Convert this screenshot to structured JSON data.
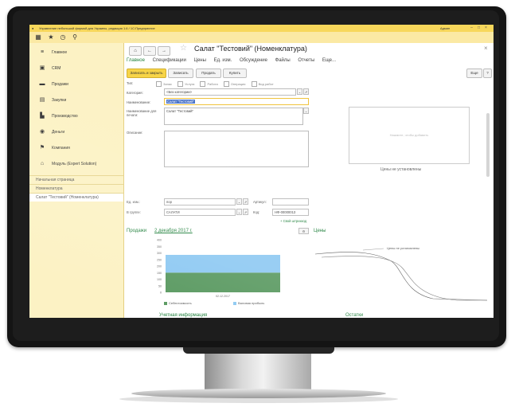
{
  "window": {
    "title": "Управление небольшой фирмой для Украины, редакция 1.6 / 1С:Предприятие",
    "user": "Админ",
    "controls": [
      "–",
      "□",
      "×"
    ]
  },
  "sidebar": {
    "items": [
      {
        "label": "Главное",
        "icon": "menu-icon"
      },
      {
        "label": "CRM",
        "icon": "crm-icon"
      },
      {
        "label": "Продажи",
        "icon": "sales-icon"
      },
      {
        "label": "Закупки",
        "icon": "purchases-icon"
      },
      {
        "label": "Производство",
        "icon": "production-icon"
      },
      {
        "label": "Деньги",
        "icon": "money-icon"
      },
      {
        "label": "Компания",
        "icon": "flag-icon"
      },
      {
        "label": "Модуль (Expert Solution)",
        "icon": "module-icon"
      }
    ],
    "open_windows": [
      {
        "label": "Начальная страница",
        "active": false
      },
      {
        "label": "Номенклатура",
        "active": false
      },
      {
        "label": "Салат \"Тестовий\" (Номенклатура)",
        "active": true
      }
    ]
  },
  "document": {
    "title": "Салат \"Тестовий\" (Номенклатура)",
    "tabs": [
      "Главное",
      "Спецификации",
      "Цены",
      "Ед. изм.",
      "Обсуждение",
      "Файлы",
      "Отчеты",
      "Еще..."
    ],
    "active_tab": "Главное",
    "commands": {
      "save_close": "Записать и закрыть",
      "save": "Записать",
      "create": "Продать",
      "buy": "Купить",
      "more": "Еще",
      "help": "?"
    },
    "type_label": "Тип:",
    "types": [
      "Запас",
      "Услуга",
      "Работа",
      "Операция",
      "Вид работ"
    ],
    "fields": {
      "category_label": "Категория:",
      "category_value": "<Без категории>",
      "name_label": "Наименование:",
      "name_value": "Салат \"Тестовий\"",
      "fullname_label": "Наименование для печати:",
      "fullname_value": "Салат \"Тестовий\"",
      "description_label": "Описание:",
      "unit_label": "Ед. изм.:",
      "unit_value": "пор",
      "article_label": "Артикул:",
      "group_label": "В группе:",
      "group_value": "САЛАТИ",
      "code_label": "Код:",
      "code_value": "НФ-00000013",
      "barcode_link": "+ Свой штрихкод"
    },
    "image_placeholder": "Нажмите, чтобы добавить",
    "prices_empty": "Цены не установлены",
    "sales_title": "Продажи",
    "sales_date": "2 декабря 2017 г.",
    "prices_title": "Цены",
    "prices_chart_note": "Цены не установлены",
    "accounting_title": "Учетная информация",
    "stock_title": "Остатки",
    "colors": {
      "accent_yellow": "#f7d447",
      "accent_green": "#1e7f3a",
      "chart_blue": "#8ec9f2",
      "chart_green": "#5b9a62"
    }
  },
  "chart_data": {
    "type": "bar",
    "categories": [
      "02.12.2017"
    ],
    "series": [
      {
        "name": "Себестоимость",
        "values": [
          150
        ]
      },
      {
        "name": "Валовая прибыль",
        "values": [
          135
        ]
      }
    ],
    "stacked": true,
    "yticks": [
      "400",
      "350",
      "300",
      "250",
      "200",
      "150",
      "100",
      "50",
      "0"
    ],
    "ylim": [
      0,
      400
    ]
  }
}
